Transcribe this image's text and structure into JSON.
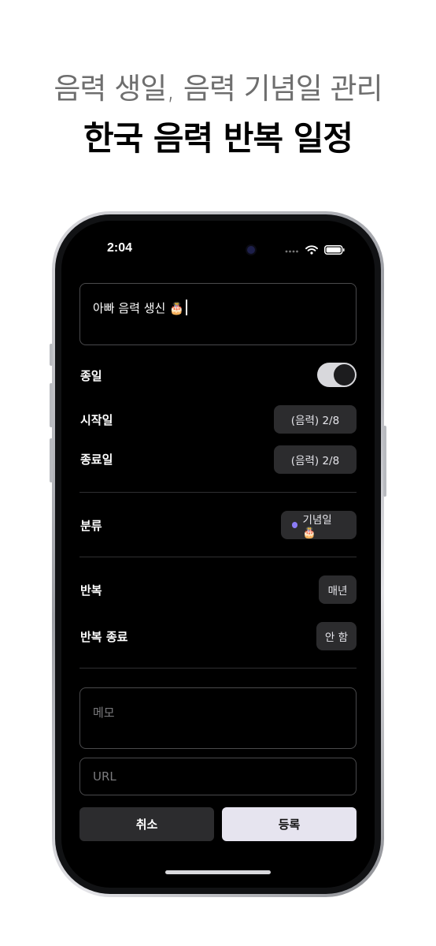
{
  "promo": {
    "subtitle": "음력 생일, 음력 기념일 관리",
    "title": "한국 음력 반복 일정"
  },
  "status_bar": {
    "time": "2:04"
  },
  "form": {
    "event_title": "아빠 음력 생신 🎂",
    "all_day": {
      "label": "종일",
      "on": true
    },
    "start_date": {
      "label": "시작일",
      "value": "(음력) 2/8"
    },
    "end_date": {
      "label": "종료일",
      "value": "(음력) 2/8"
    },
    "category": {
      "label": "분류",
      "value": "기념일 🎂",
      "color": "#8b7cf6"
    },
    "repeat": {
      "label": "반복",
      "value": "매년"
    },
    "repeat_end": {
      "label": "반복 종료",
      "value": "안 함"
    },
    "memo_placeholder": "메모",
    "url_placeholder": "URL",
    "cancel_label": "취소",
    "register_label": "등록"
  }
}
